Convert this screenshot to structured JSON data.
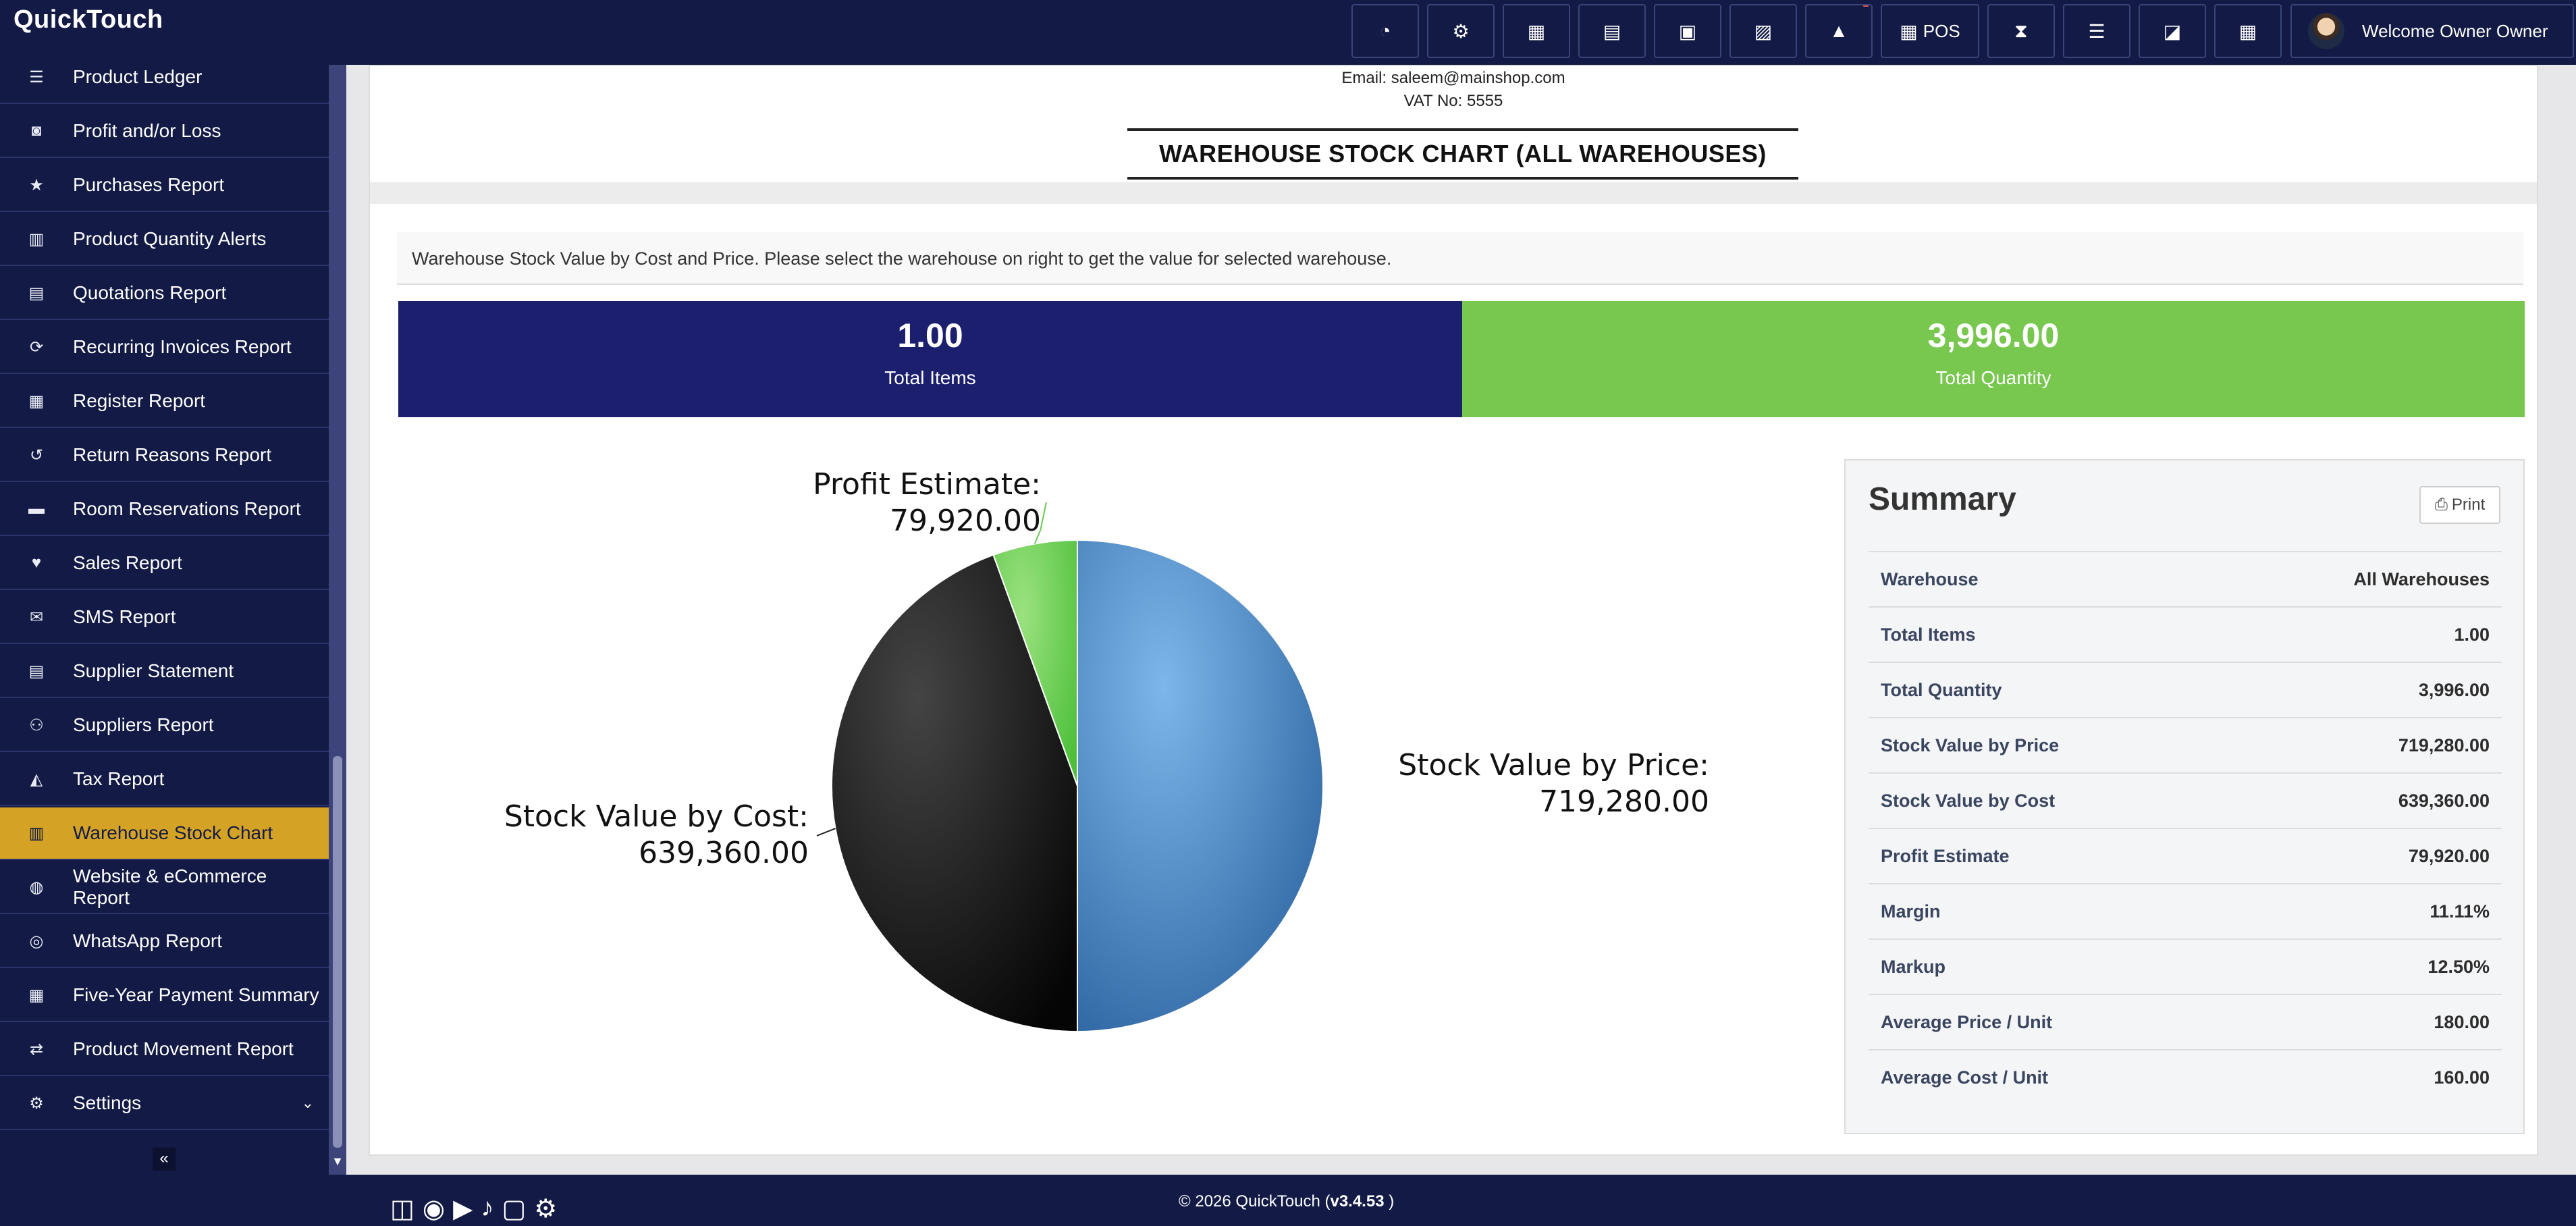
{
  "app": {
    "title": "QuickTouch"
  },
  "topbar": {
    "buttons": [
      {
        "name": "dashboard-icon",
        "glyph": "◔"
      },
      {
        "name": "settings-cogs-icon",
        "glyph": "⚙"
      },
      {
        "name": "calculator-icon",
        "glyph": "▦"
      },
      {
        "name": "calendar-icon",
        "glyph": "▤"
      },
      {
        "name": "document-icon",
        "glyph": "▣"
      },
      {
        "name": "flag-uk-icon",
        "glyph": "▨"
      },
      {
        "name": "alert-icon",
        "glyph": "▲"
      },
      {
        "name": "pos-icon",
        "glyph": "▦"
      },
      {
        "name": "hourglass-icon",
        "glyph": "⧗"
      },
      {
        "name": "list-icon",
        "glyph": "☰"
      },
      {
        "name": "eraser-icon",
        "glyph": "◪"
      },
      {
        "name": "grid-icon",
        "glyph": "▦"
      }
    ],
    "pos_label": "POS",
    "welcome": "Welcome Owner Owner"
  },
  "sidebar": {
    "items": [
      {
        "label": "Product Ledger",
        "icon": "list-icon",
        "glyph": "☰"
      },
      {
        "label": "Profit and/or Loss",
        "icon": "money-icon",
        "glyph": "◙"
      },
      {
        "label": "Purchases Report",
        "icon": "star-icon",
        "glyph": "★"
      },
      {
        "label": "Product Quantity Alerts",
        "icon": "bar-chart-icon",
        "glyph": "▥"
      },
      {
        "label": "Quotations Report",
        "icon": "file-icon",
        "glyph": "▤"
      },
      {
        "label": "Recurring Invoices Report",
        "icon": "refresh-icon",
        "glyph": "⟳"
      },
      {
        "label": "Register Report",
        "icon": "grid-icon",
        "glyph": "▦"
      },
      {
        "label": "Return Reasons Report",
        "icon": "undo-icon",
        "glyph": "↺"
      },
      {
        "label": "Room Reservations Report",
        "icon": "bed-icon",
        "glyph": "▬"
      },
      {
        "label": "Sales Report",
        "icon": "heart-icon",
        "glyph": "♥"
      },
      {
        "label": "SMS Report",
        "icon": "comments-icon",
        "glyph": "✉"
      },
      {
        "label": "Supplier Statement",
        "icon": "file-text-icon",
        "glyph": "▤"
      },
      {
        "label": "Suppliers Report",
        "icon": "users-icon",
        "glyph": "⚇"
      },
      {
        "label": "Tax Report",
        "icon": "area-chart-icon",
        "glyph": "◭"
      },
      {
        "label": "Warehouse Stock Chart",
        "icon": "building-icon",
        "glyph": "▥",
        "active": true
      },
      {
        "label": "Website & eCommerce Report",
        "icon": "globe-icon",
        "glyph": "◍"
      },
      {
        "label": "WhatsApp Report",
        "icon": "whatsapp-icon",
        "glyph": "◎"
      },
      {
        "label": "Five-Year Payment Summary",
        "icon": "calendar-icon",
        "glyph": "▦"
      },
      {
        "label": "Product Movement Report",
        "icon": "exchange-icon",
        "glyph": "⇄"
      },
      {
        "label": "Settings",
        "icon": "gear-icon",
        "glyph": "⚙",
        "chevron": true
      }
    ]
  },
  "header": {
    "email": "Email: saleem@mainshop.com",
    "vat": "VAT No: 5555",
    "title": "WAREHOUSE STOCK CHART (ALL WAREHOUSES)"
  },
  "intro": "Warehouse Stock Value by Cost and Price. Please select the warehouse on right to get the value for selected warehouse.",
  "kpis": {
    "items_value": "1.00",
    "items_label": "Total Items",
    "qty_value": "3,996.00",
    "qty_label": "Total Quantity"
  },
  "chart_data": {
    "type": "pie",
    "slices": [
      {
        "label": "Stock Value by Price",
        "value": 719280.0,
        "display": "719,280.00",
        "color": "#3f7fbf"
      },
      {
        "label": "Stock Value by Cost",
        "value": 639360.0,
        "display": "639,360.00",
        "color": "#1a1a1a"
      },
      {
        "label": "Profit Estimate",
        "value": 79920.0,
        "display": "79,920.00",
        "color": "#66cc55"
      }
    ],
    "legend": "none"
  },
  "summary": {
    "title": "Summary",
    "print_label": "Print",
    "rows": [
      {
        "label": "Warehouse",
        "value": "All Warehouses"
      },
      {
        "label": "Total Items",
        "value": "1.00"
      },
      {
        "label": "Total Quantity",
        "value": "3,996.00"
      },
      {
        "label": "Stock Value by Price",
        "value": "719,280.00"
      },
      {
        "label": "Stock Value by Cost",
        "value": "639,360.00"
      },
      {
        "label": "Profit Estimate",
        "value": "79,920.00"
      },
      {
        "label": "Margin",
        "value": "11.11%"
      },
      {
        "label": "Markup",
        "value": "12.50%"
      },
      {
        "label": "Average Price / Unit",
        "value": "180.00"
      },
      {
        "label": "Average Cost / Unit",
        "value": "160.00"
      }
    ]
  },
  "footer": {
    "copyright_prefix": "© 2026 QuickTouch (",
    "version": "v3.4.53",
    "copyright_suffix": " )",
    "tools": [
      {
        "name": "screenshot-tool-icon",
        "glyph": "◫"
      },
      {
        "name": "camera-icon",
        "glyph": "◉"
      },
      {
        "name": "video-icon",
        "glyph": "▶"
      },
      {
        "name": "microphone-icon",
        "glyph": "♪"
      },
      {
        "name": "window-icon",
        "glyph": "▢"
      },
      {
        "name": "gear-icon",
        "glyph": "⚙"
      }
    ]
  }
}
